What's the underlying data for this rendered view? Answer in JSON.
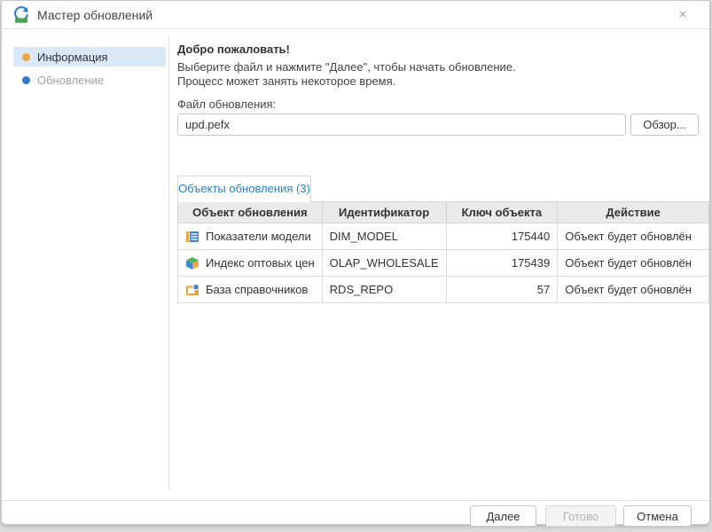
{
  "window": {
    "title": "Мастер обновлений",
    "close_glyph": "×"
  },
  "sidebar": {
    "items": [
      {
        "label": "Информация",
        "active": true,
        "dot_color": "#f5a33c"
      },
      {
        "label": "Обновление",
        "active": false,
        "dot_color": "#2b7cd3"
      }
    ]
  },
  "main": {
    "welcome_title": "Добро пожаловать!",
    "welcome_line1": "Выберите файл и нажмите \"Далее\", чтобы начать обновление.",
    "welcome_line2": "Процесс может занять некоторое время.",
    "file_label": "Файл обновления:",
    "file_value": "upd.pefx",
    "browse_label": "Обзор...",
    "tab_label": "Объекты обновления (3)",
    "table": {
      "headers": [
        "Объект обновления",
        "Идентификатор",
        "Ключ объекта",
        "Действие"
      ],
      "rows": [
        {
          "icon": "model-dimension-icon",
          "name": "Показатели модели",
          "id": "DIM_MODEL",
          "key": "175440",
          "action": "Объект будет обновлён"
        },
        {
          "icon": "olap-cube-icon",
          "name": "Индекс оптовых цен",
          "id": "OLAP_WHOLESALE",
          "key": "175439",
          "action": "Объект будет обновлён"
        },
        {
          "icon": "repository-icon",
          "name": "База справочников",
          "id": "RDS_REPO",
          "key": "57",
          "action": "Объект будет обновлён"
        }
      ]
    }
  },
  "footer": {
    "next_label": "Далее",
    "finish_label": "Готово",
    "cancel_label": "Отмена"
  },
  "colors": {
    "accent_blue": "#2b7fc2",
    "step_orange": "#f5a33c",
    "step_blue": "#2b7cd3",
    "icon_green": "#4aa64c",
    "icon_orange": "#f5a33c",
    "header_gray": "#eaeaea",
    "active_step_bg": "#d9e8f7"
  }
}
